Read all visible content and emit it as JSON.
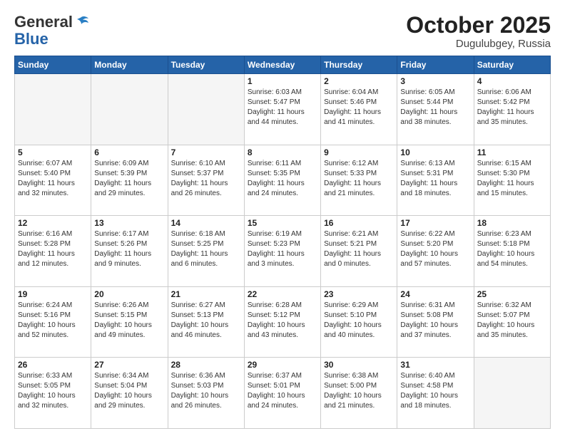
{
  "header": {
    "logo_general": "General",
    "logo_blue": "Blue",
    "month_title": "October 2025",
    "location": "Dugulubgey, Russia"
  },
  "calendar": {
    "days_of_week": [
      "Sunday",
      "Monday",
      "Tuesday",
      "Wednesday",
      "Thursday",
      "Friday",
      "Saturday"
    ],
    "weeks": [
      [
        {
          "day": "",
          "info": ""
        },
        {
          "day": "",
          "info": ""
        },
        {
          "day": "",
          "info": ""
        },
        {
          "day": "1",
          "info": "Sunrise: 6:03 AM\nSunset: 5:47 PM\nDaylight: 11 hours\nand 44 minutes."
        },
        {
          "day": "2",
          "info": "Sunrise: 6:04 AM\nSunset: 5:46 PM\nDaylight: 11 hours\nand 41 minutes."
        },
        {
          "day": "3",
          "info": "Sunrise: 6:05 AM\nSunset: 5:44 PM\nDaylight: 11 hours\nand 38 minutes."
        },
        {
          "day": "4",
          "info": "Sunrise: 6:06 AM\nSunset: 5:42 PM\nDaylight: 11 hours\nand 35 minutes."
        }
      ],
      [
        {
          "day": "5",
          "info": "Sunrise: 6:07 AM\nSunset: 5:40 PM\nDaylight: 11 hours\nand 32 minutes."
        },
        {
          "day": "6",
          "info": "Sunrise: 6:09 AM\nSunset: 5:39 PM\nDaylight: 11 hours\nand 29 minutes."
        },
        {
          "day": "7",
          "info": "Sunrise: 6:10 AM\nSunset: 5:37 PM\nDaylight: 11 hours\nand 26 minutes."
        },
        {
          "day": "8",
          "info": "Sunrise: 6:11 AM\nSunset: 5:35 PM\nDaylight: 11 hours\nand 24 minutes."
        },
        {
          "day": "9",
          "info": "Sunrise: 6:12 AM\nSunset: 5:33 PM\nDaylight: 11 hours\nand 21 minutes."
        },
        {
          "day": "10",
          "info": "Sunrise: 6:13 AM\nSunset: 5:31 PM\nDaylight: 11 hours\nand 18 minutes."
        },
        {
          "day": "11",
          "info": "Sunrise: 6:15 AM\nSunset: 5:30 PM\nDaylight: 11 hours\nand 15 minutes."
        }
      ],
      [
        {
          "day": "12",
          "info": "Sunrise: 6:16 AM\nSunset: 5:28 PM\nDaylight: 11 hours\nand 12 minutes."
        },
        {
          "day": "13",
          "info": "Sunrise: 6:17 AM\nSunset: 5:26 PM\nDaylight: 11 hours\nand 9 minutes."
        },
        {
          "day": "14",
          "info": "Sunrise: 6:18 AM\nSunset: 5:25 PM\nDaylight: 11 hours\nand 6 minutes."
        },
        {
          "day": "15",
          "info": "Sunrise: 6:19 AM\nSunset: 5:23 PM\nDaylight: 11 hours\nand 3 minutes."
        },
        {
          "day": "16",
          "info": "Sunrise: 6:21 AM\nSunset: 5:21 PM\nDaylight: 11 hours\nand 0 minutes."
        },
        {
          "day": "17",
          "info": "Sunrise: 6:22 AM\nSunset: 5:20 PM\nDaylight: 10 hours\nand 57 minutes."
        },
        {
          "day": "18",
          "info": "Sunrise: 6:23 AM\nSunset: 5:18 PM\nDaylight: 10 hours\nand 54 minutes."
        }
      ],
      [
        {
          "day": "19",
          "info": "Sunrise: 6:24 AM\nSunset: 5:16 PM\nDaylight: 10 hours\nand 52 minutes."
        },
        {
          "day": "20",
          "info": "Sunrise: 6:26 AM\nSunset: 5:15 PM\nDaylight: 10 hours\nand 49 minutes."
        },
        {
          "day": "21",
          "info": "Sunrise: 6:27 AM\nSunset: 5:13 PM\nDaylight: 10 hours\nand 46 minutes."
        },
        {
          "day": "22",
          "info": "Sunrise: 6:28 AM\nSunset: 5:12 PM\nDaylight: 10 hours\nand 43 minutes."
        },
        {
          "day": "23",
          "info": "Sunrise: 6:29 AM\nSunset: 5:10 PM\nDaylight: 10 hours\nand 40 minutes."
        },
        {
          "day": "24",
          "info": "Sunrise: 6:31 AM\nSunset: 5:08 PM\nDaylight: 10 hours\nand 37 minutes."
        },
        {
          "day": "25",
          "info": "Sunrise: 6:32 AM\nSunset: 5:07 PM\nDaylight: 10 hours\nand 35 minutes."
        }
      ],
      [
        {
          "day": "26",
          "info": "Sunrise: 6:33 AM\nSunset: 5:05 PM\nDaylight: 10 hours\nand 32 minutes."
        },
        {
          "day": "27",
          "info": "Sunrise: 6:34 AM\nSunset: 5:04 PM\nDaylight: 10 hours\nand 29 minutes."
        },
        {
          "day": "28",
          "info": "Sunrise: 6:36 AM\nSunset: 5:03 PM\nDaylight: 10 hours\nand 26 minutes."
        },
        {
          "day": "29",
          "info": "Sunrise: 6:37 AM\nSunset: 5:01 PM\nDaylight: 10 hours\nand 24 minutes."
        },
        {
          "day": "30",
          "info": "Sunrise: 6:38 AM\nSunset: 5:00 PM\nDaylight: 10 hours\nand 21 minutes."
        },
        {
          "day": "31",
          "info": "Sunrise: 6:40 AM\nSunset: 4:58 PM\nDaylight: 10 hours\nand 18 minutes."
        },
        {
          "day": "",
          "info": ""
        }
      ]
    ]
  }
}
